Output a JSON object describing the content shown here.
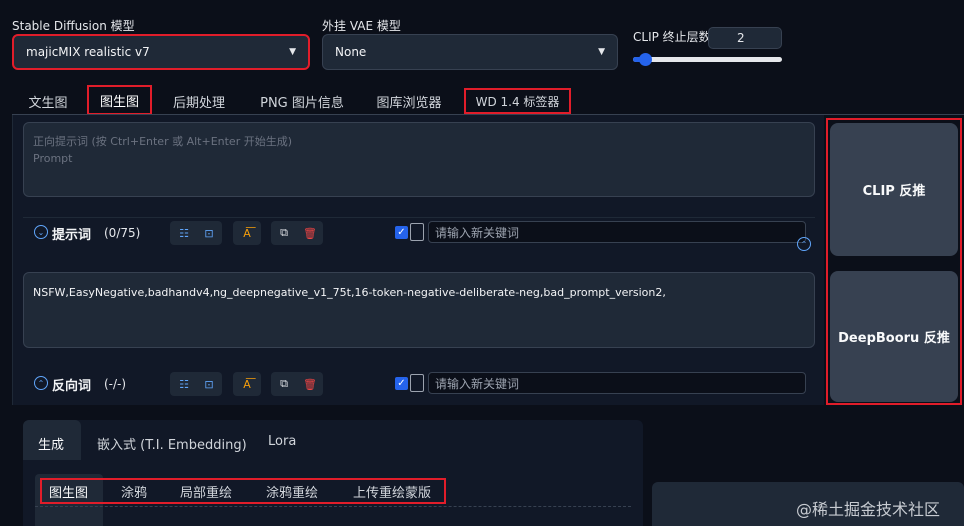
{
  "header": {
    "checkpoint_label": "Stable Diffusion 模型",
    "checkpoint_value": "majicMIX realistic v7",
    "vae_label": "外挂 VAE 模型",
    "vae_value": "None",
    "clip_label": "CLIP 终止层数",
    "clip_value": "2",
    "clip_slider_fraction": 0.08
  },
  "tabs": [
    "文生图",
    "图生图",
    "后期处理",
    "PNG 图片信息",
    "图库浏览器",
    "WD 1.4 标签器"
  ],
  "active_tab": "图生图",
  "prompt": {
    "placeholder": "正向提示词 (按 Ctrl+Enter 或 Alt+Enter 开始生成)\nPrompt",
    "toggle_label": "提示词",
    "count": "(0/75)",
    "keyword_placeholder": "请输入新关键词"
  },
  "negative": {
    "value": "NSFW,EasyNegative,badhandv4,ng_deepnegative_v1_75t,16-token-negative-deliberate-neg,bad_prompt_version2,",
    "toggle_label": "反向词",
    "count": "(-/-)",
    "keyword_placeholder": "请输入新关键词"
  },
  "buttons": {
    "clip": "CLIP 反推",
    "deepbooru": "DeepBooru 反推"
  },
  "lower_tabs": [
    "生成",
    "嵌入式 (T.I. Embedding)",
    "Lora"
  ],
  "mode_tabs": [
    "图生图",
    "涂鸦",
    "局部重绘",
    "涂鸦重绘",
    "上传重绘蒙版"
  ],
  "watermark": "@稀土掘金技术社区",
  "colors": {
    "accent": "#2563eb",
    "highlight": "#e11d2a",
    "bg": "#0b0f19"
  }
}
